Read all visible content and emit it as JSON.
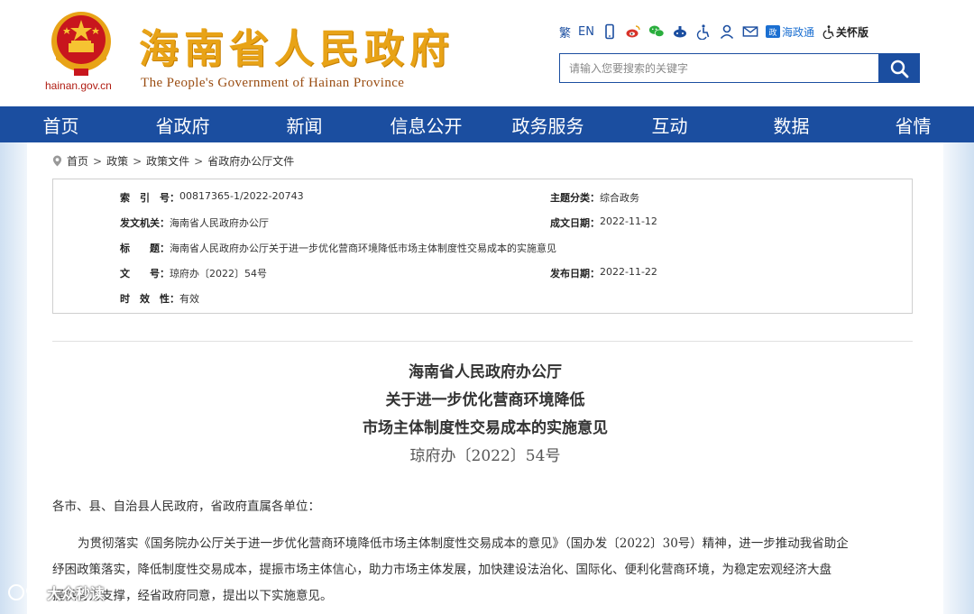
{
  "header": {
    "domain": "hainan.gov.cn",
    "title": "海南省人民政府",
    "subtitle": "The People's Government  of Hainan Province",
    "toolbar": {
      "traditional": "繁",
      "english": "EN",
      "hainan_gov_app": "海政通",
      "care_version": "关怀版"
    },
    "search": {
      "placeholder": "请输入您要搜索的关键字"
    }
  },
  "nav": {
    "items": [
      "首页",
      "省政府",
      "新闻",
      "信息公开",
      "政务服务",
      "互动",
      "数据",
      "省情"
    ]
  },
  "breadcrumb": {
    "items": [
      "首页",
      "政策",
      "政策文件",
      "省政府办公厅文件"
    ],
    "separator": ">"
  },
  "meta": {
    "index_label": "索　引　号：",
    "index_value": "00817365-1/2022-20743",
    "category_label": "主题分类：",
    "category_value": "综合政务",
    "issuer_label": "发文机关：",
    "issuer_value": "海南省人民政府办公厅",
    "date_label": "成文日期：",
    "date_value": "2022-11-12",
    "title_label": "标　　题：",
    "title_value": "海南省人民政府办公厅关于进一步优化营商环境降低市场主体制度性交易成本的实施意见",
    "docno_label": "文　　号：",
    "docno_value": "琼府办〔2022〕54号",
    "publish_label": "发布日期：",
    "publish_value": "2022-11-22",
    "validity_label": "时　效　性：",
    "validity_value": "有效"
  },
  "document": {
    "title_line1": "海南省人民政府办公厅",
    "title_line2": "关于进一步优化营商环境降低",
    "title_line3": "市场主体制度性交易成本的实施意见",
    "number": "琼府办〔2022〕54号",
    "salutation": "各市、县、自治县人民政府，省政府直属各单位：",
    "para1_line1": "为贯彻落实《国务院办公厅关于进一步优化营商环境降低市场主体制度性交易成本的意见》（国办发〔2022〕30号）精神，进一步推动我省助企",
    "para1_line2": "纾困政策落实，降低制度性交易成本，提振市场主体信心，助力市场主体发展，加快建设法治化、国际化、便利化营商环境，为稳定宏观经济大盘",
    "para1_line3": "提供有力支撑，经省政府同意，提出以下实施意见。"
  },
  "watermark": {
    "text": "大众秒读"
  },
  "colors": {
    "brand_blue": "#1b4ea0",
    "title_gold": "#e8a317",
    "emblem_red": "#c8161d"
  }
}
